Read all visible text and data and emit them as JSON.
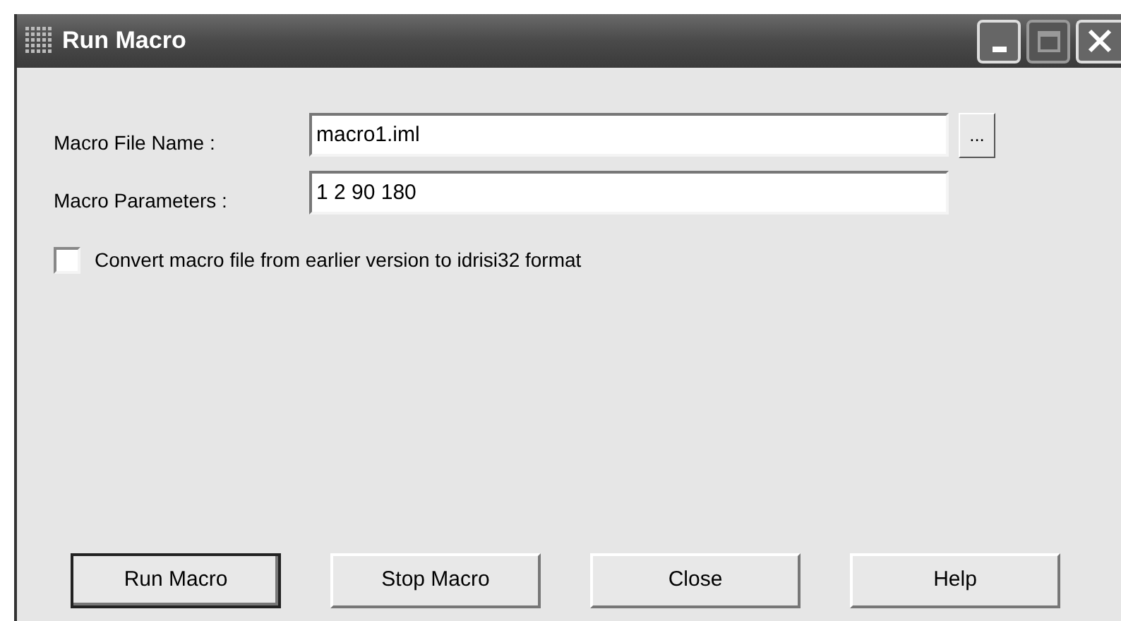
{
  "window": {
    "title": "Run Macro"
  },
  "fields": [
    {
      "label": "Macro File Name :",
      "value": "macro1.iml",
      "browse": "..."
    },
    {
      "label": "Macro Parameters :",
      "value": "1 2 90 180"
    }
  ],
  "convert_option": {
    "label": "Convert macro file from earlier version to idrisi32 format",
    "checked": false
  },
  "buttons": [
    {
      "label": "Run Macro",
      "default": true
    },
    {
      "label": "Stop Macro",
      "default": false
    },
    {
      "label": "Close",
      "default": false
    },
    {
      "label": "Help",
      "default": false
    }
  ]
}
